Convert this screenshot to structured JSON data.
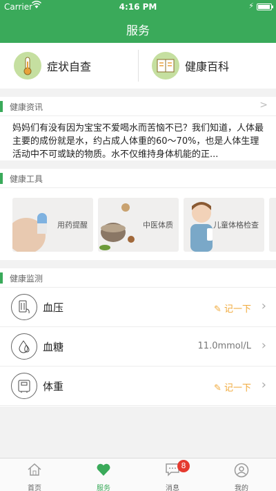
{
  "status": {
    "carrier": "Carrier",
    "time": "4:16 PM",
    "battery_level": 0.95
  },
  "header": {
    "title": "服务"
  },
  "quick_links": [
    {
      "label": "症状自查",
      "icon": "thermometer-icon"
    },
    {
      "label": "健康百科",
      "icon": "book-icon"
    }
  ],
  "news": {
    "section_title": "健康资讯",
    "text": "妈妈们有没有因为宝宝不爱喝水而苦恼不已？我们知道，人体最主要的成份就是水，约占成人体重的60～70%，也是人体生理活动中不可或缺的物质。水不仅维持身体机能的正..."
  },
  "tools": {
    "section_title": "健康工具",
    "items": [
      {
        "label": "用药提醒",
        "icon": "pill-icon"
      },
      {
        "label": "中医体质",
        "icon": "herbs-icon"
      },
      {
        "label": "儿童体格检查",
        "icon": "child-icon"
      }
    ]
  },
  "monitor": {
    "section_title": "健康监测",
    "rows": [
      {
        "name": "血压",
        "action": "记一下",
        "icon": "blood-pressure-icon"
      },
      {
        "name": "血糖",
        "value": "11.0mmol/L",
        "icon": "blood-drop-icon"
      },
      {
        "name": "体重",
        "action": "记一下",
        "icon": "scale-icon"
      }
    ]
  },
  "tabbar": {
    "items": [
      {
        "label": "首页",
        "icon": "home-icon"
      },
      {
        "label": "服务",
        "icon": "heart-icon"
      },
      {
        "label": "消息",
        "icon": "message-icon",
        "badge": "8"
      },
      {
        "label": "我的",
        "icon": "user-icon"
      }
    ]
  },
  "colors": {
    "accent": "#3aaa5a",
    "badge": "#e53a2f",
    "record": "#f0a93a"
  }
}
